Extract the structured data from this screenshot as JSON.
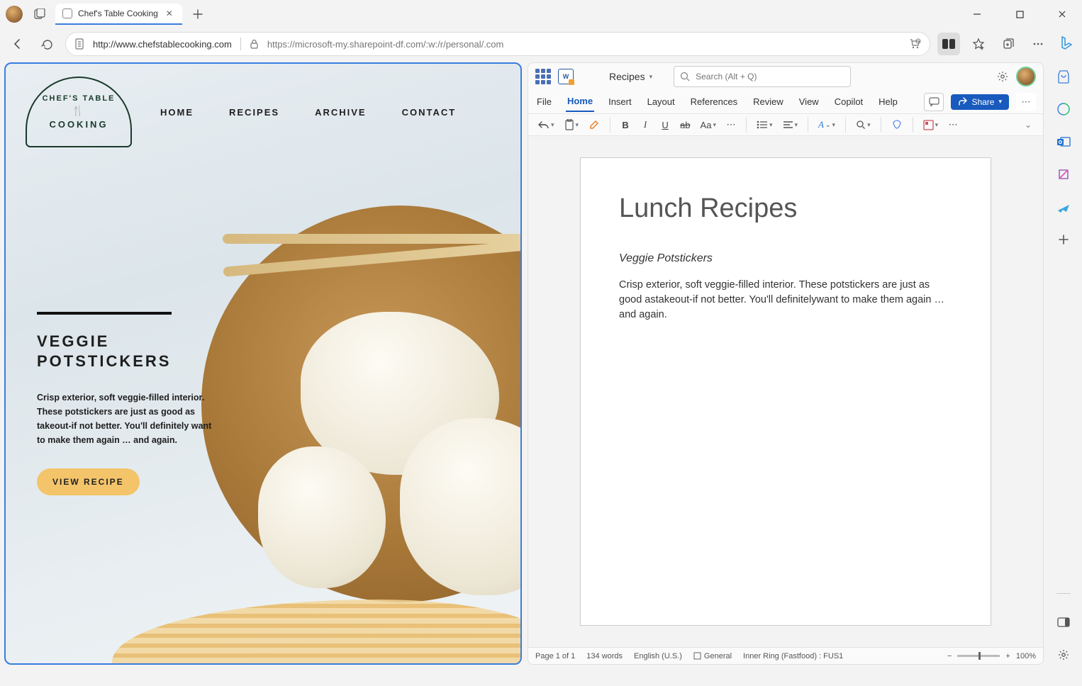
{
  "browser": {
    "tab_title": "Chef's Table Cooking",
    "url_left": "http://www.chefstablecooking.com",
    "url_right": "https://microsoft-my.sharepoint-df.com/:w:/r/personal/.com"
  },
  "site": {
    "logo_line1": "CHEF'S TABLE",
    "logo_line2": "COOKING",
    "nav": {
      "home": "HOME",
      "recipes": "RECIPES",
      "archive": "ARCHIVE",
      "contact": "CONTACT"
    },
    "headline": "VEGGIE POTSTICKERS",
    "blurb": "Crisp exterior, soft veggie-filled interior. These potstickers are just as good as takeout-if not better. You'll definitely want to make them again … and again.",
    "view_btn": "VIEW RECIPE"
  },
  "word": {
    "app_label": "W",
    "doc_title": "Recipes",
    "search_placeholder": "Search (Alt + Q)",
    "tabs": {
      "file": "File",
      "home": "Home",
      "insert": "Insert",
      "layout": "Layout",
      "references": "References",
      "review": "Review",
      "view": "View",
      "copilot": "Copilot",
      "help": "Help"
    },
    "share": "Share",
    "doc": {
      "title": "Lunch Recipes",
      "h2": "Veggie Potstickers",
      "body": "Crisp exterior, soft veggie-filled interior. These potstickers are just as good astakeout-if not better. You'll definitelywant to make them again … and again."
    },
    "status": {
      "pages": "Page 1 of 1",
      "words": "134 words",
      "lang": "English (U.S.)",
      "general": "General",
      "ring": "Inner Ring (Fastfood) : FUS1",
      "zoom": "100%"
    }
  }
}
